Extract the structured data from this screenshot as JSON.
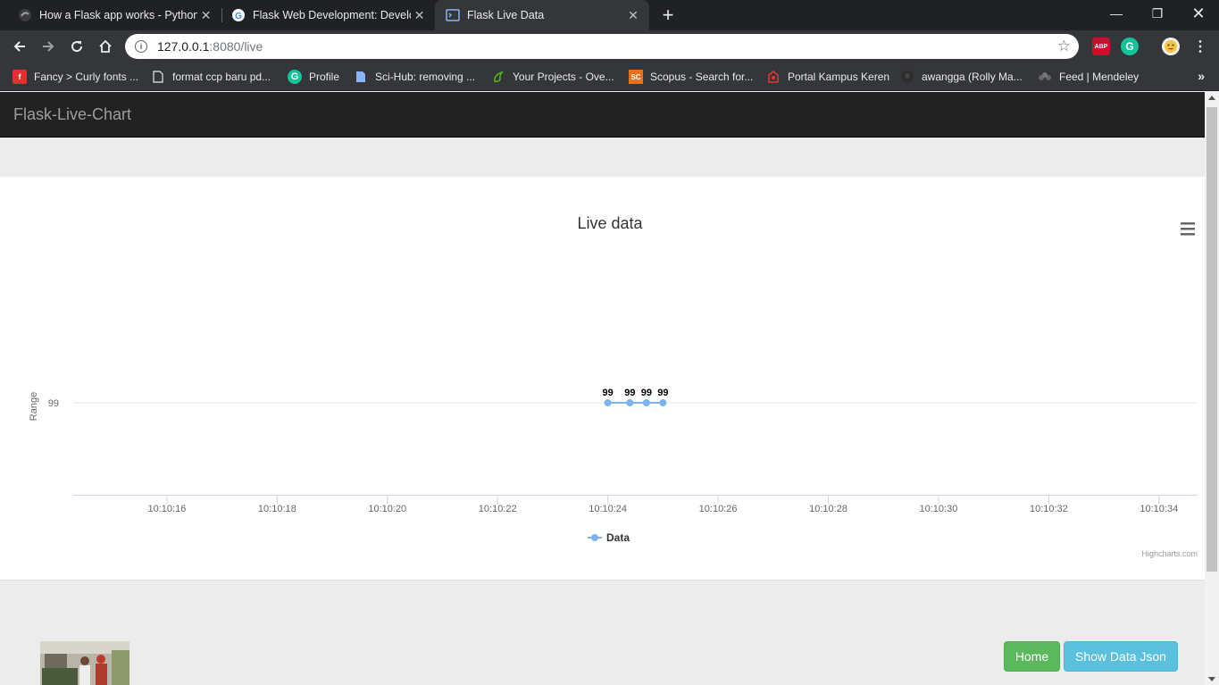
{
  "browser": {
    "tabs": [
      {
        "title": "How a Flask app works - PythonH",
        "icon": "python-favicon"
      },
      {
        "title": "Flask Web Development: Develop",
        "icon": "google-favicon"
      },
      {
        "title": "Flask Live Data",
        "icon": "terminal-favicon"
      }
    ],
    "url_host": "127.0.0.1",
    "url_rest": ":8080/live",
    "extensions": {
      "abp": "ABP"
    },
    "bookmarks": [
      {
        "label": "Fancy > Curly fonts ...",
        "icon": "flipkart-icon"
      },
      {
        "label": "format ccp baru pd...",
        "icon": "page-icon"
      },
      {
        "label": "Profile",
        "icon": "grammarly-icon"
      },
      {
        "label": "Sci-Hub: removing ...",
        "icon": "doc-icon"
      },
      {
        "label": "Your Projects - Ove...",
        "icon": "overleaf-icon"
      },
      {
        "label": "Scopus - Search for...",
        "icon": "scopus-icon"
      },
      {
        "label": "Portal Kampus Keren",
        "icon": "campus-icon"
      },
      {
        "label": "awangga (Rolly Ma...",
        "icon": "github-icon"
      },
      {
        "label": "Feed | Mendeley",
        "icon": "mendeley-icon"
      }
    ],
    "scopus_badge": "SC"
  },
  "app": {
    "brand": "Flask-Live-Chart",
    "buttons": {
      "home": "Home",
      "show_json": "Show Data Json"
    }
  },
  "chart_data": {
    "type": "line",
    "title": "Live data",
    "ylabel": "Range",
    "xlabel": "",
    "y_tick_labels": [
      "99"
    ],
    "x_tick_labels": [
      "10:10:16",
      "10:10:18",
      "10:10:20",
      "10:10:22",
      "10:10:24",
      "10:10:26",
      "10:10:28",
      "10:10:30",
      "10:10:32",
      "10:10:34"
    ],
    "xlim": [
      "10:10:14.3",
      "10:10:34.7"
    ],
    "ylim": [
      98,
      100
    ],
    "series": [
      {
        "name": "Data",
        "color": "#7cb5ec",
        "x": [
          "10:10:24.0",
          "10:10:24.4",
          "10:10:24.7",
          "10:10:25.0"
        ],
        "values": [
          99,
          99,
          99,
          99
        ]
      }
    ],
    "data_labels": [
      "99",
      "99",
      "99",
      "99"
    ],
    "legend_position": "bottom-center",
    "credits": "Highcharts.com",
    "grid": true
  }
}
